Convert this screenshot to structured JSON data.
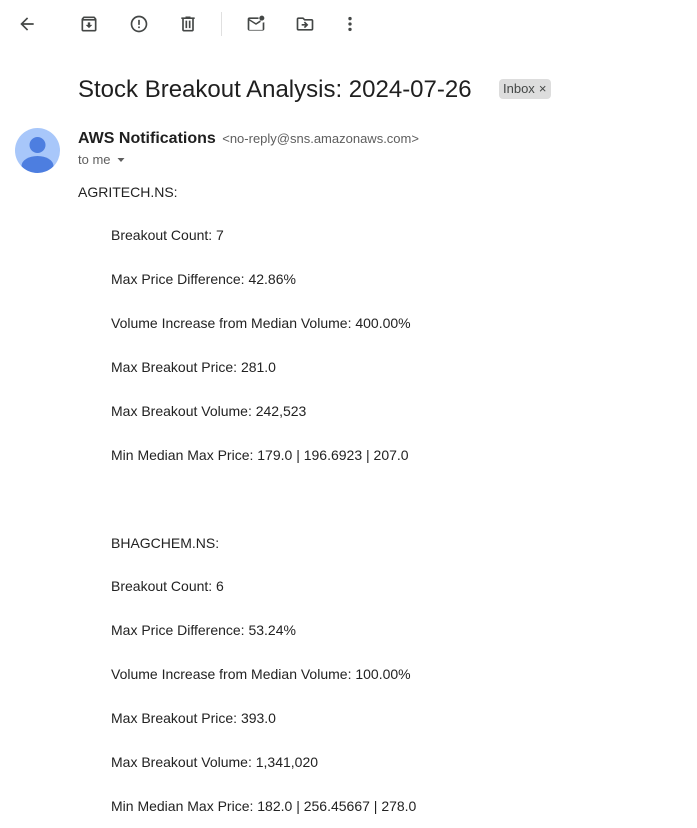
{
  "toolbar": {
    "icons": [
      "back-arrow-icon",
      "archive-icon",
      "report-spam-icon",
      "delete-icon",
      "mark-unread-icon",
      "move-to-icon",
      "more-vert-icon"
    ]
  },
  "email": {
    "subject": "Stock Breakout Analysis: 2024-07-26",
    "label_chip": "Inbox",
    "label_chip_close": "×",
    "sender_name": "AWS Notifications",
    "sender_email": "<no-reply@sns.amazonaws.com>",
    "recipient_text": "to me"
  },
  "body": {
    "stock1": {
      "symbol": "AGRITECH.NS:",
      "breakout_count": "Breakout Count: 7",
      "max_price_difference": "Max Price Difference: 42.86%",
      "volume_increase": "Volume Increase from Median Volume: 400.00%",
      "max_breakout_price": "Max Breakout Price: 281.0",
      "max_breakout_volume": "Max Breakout Volume: 242,523",
      "min_median_max_price": "Min Median Max Price: 179.0 | 196.6923 | 207.0"
    },
    "stock2": {
      "symbol": "BHAGCHEM.NS:",
      "breakout_count": "Breakout Count: 6",
      "max_price_difference": "Max Price Difference: 53.24%",
      "volume_increase": "Volume Increase from Median Volume: 100.00%",
      "max_breakout_price": "Max Breakout Price: 393.0",
      "max_breakout_volume": "Max Breakout Volume: 1,341,020",
      "min_median_max_price": "Min Median Max Price: 182.0 | 256.45667 | 278.0"
    }
  },
  "colors": {
    "icon": "#444746",
    "avatar_bg": "#a8c7fa",
    "avatar_fg": "#4d7ee0",
    "chip_bg": "#dddddd"
  }
}
